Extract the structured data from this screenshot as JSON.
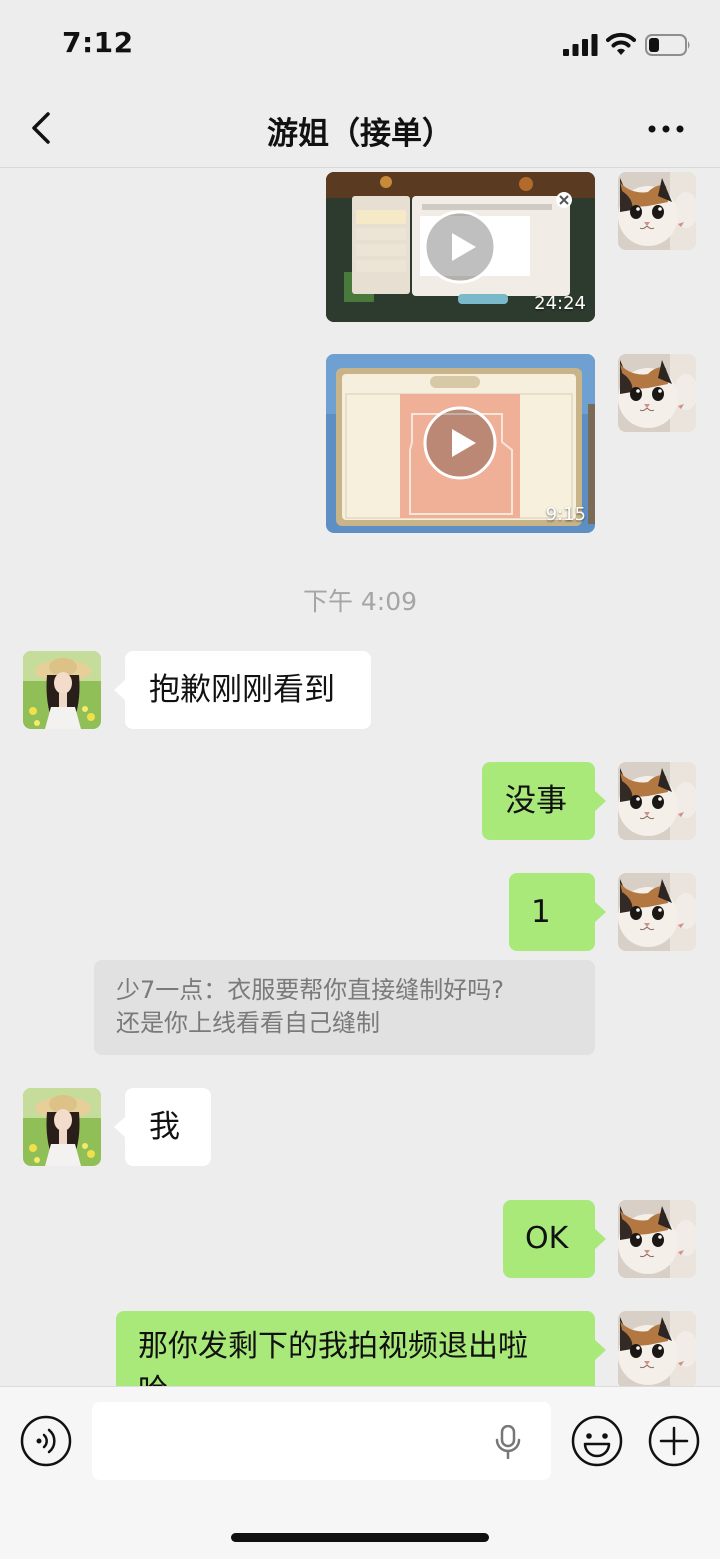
{
  "status_bar": {
    "time": "7:12"
  },
  "header": {
    "title": "游姐（接单）"
  },
  "messages": {
    "video1": {
      "duration": "24:24"
    },
    "video2": {
      "duration": "9:15"
    },
    "timestamp": "下午 4:09",
    "m1": "抱歉刚刚看到",
    "m2": "没事",
    "m3": "1",
    "quote_line1": "少7一点：衣服要帮你直接缝制好吗?",
    "quote_line2": "还是你上线看看自己缝制",
    "m4": "我",
    "m5": "OK",
    "m6": "那你发剩下的我拍视频退出啦",
    "m6_overflow": "哈"
  },
  "input_bar": {
    "text_value": ""
  },
  "icons": {
    "back": "chevron-left-icon",
    "more": "more-dots-icon",
    "voice": "voice-icon",
    "mic": "microphone-icon",
    "emoji": "emoji-icon",
    "add": "plus-icon",
    "play": "play-icon"
  },
  "colors": {
    "background": "#ededed",
    "outgoing_bubble": "#a9e97a",
    "incoming_bubble": "#ffffff",
    "timestamp": "#a5a5a5",
    "quote_bg": "#e1e1e1"
  }
}
